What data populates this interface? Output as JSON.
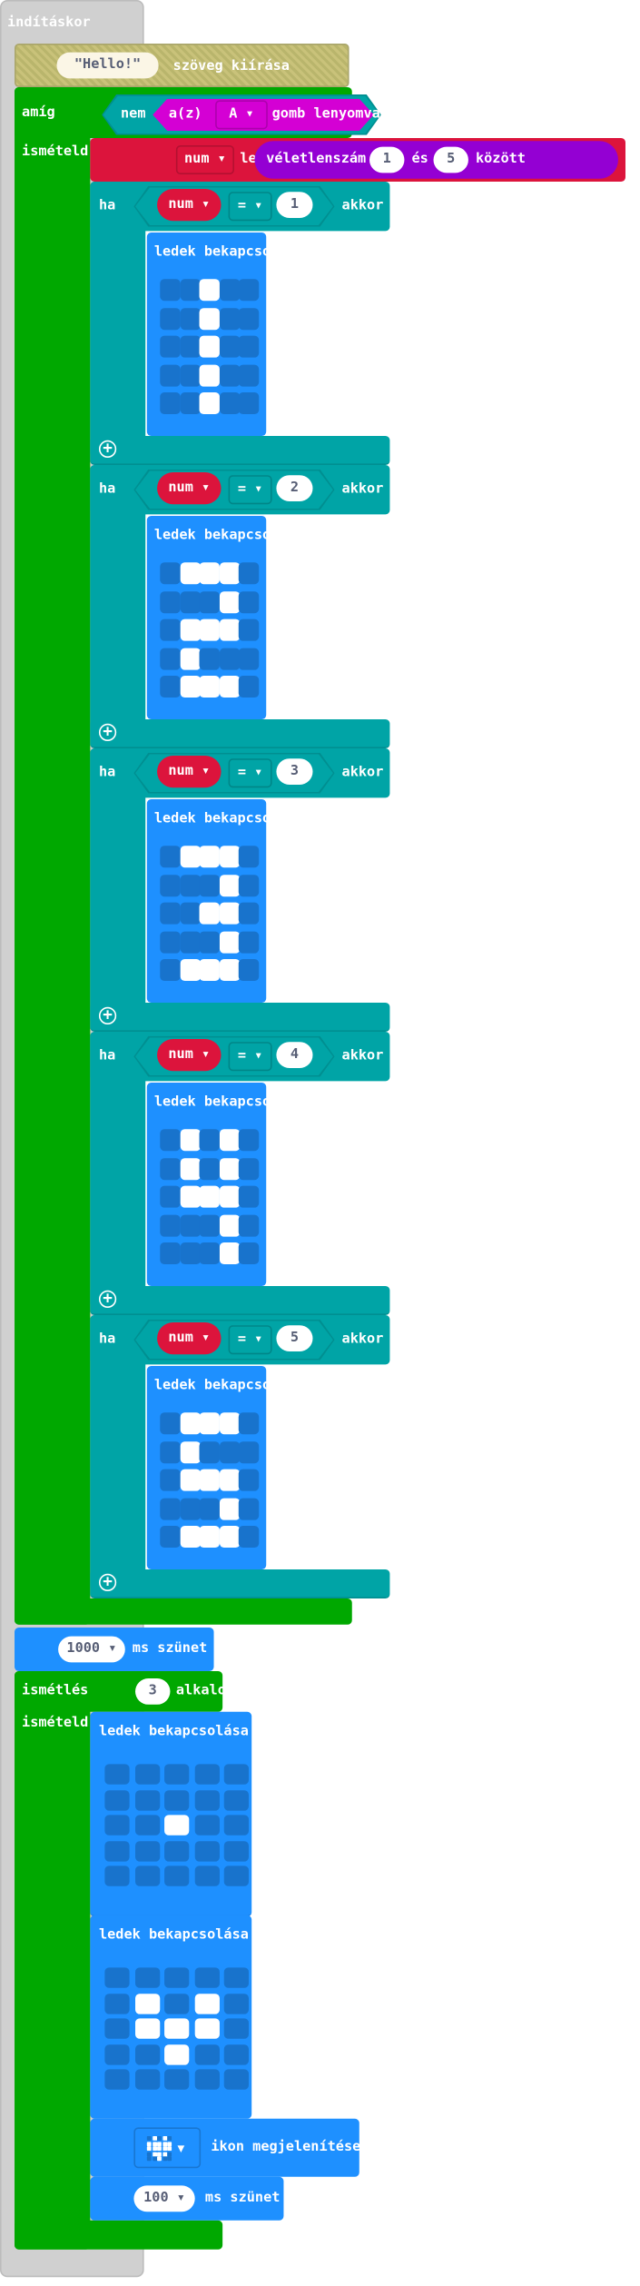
{
  "hat": {
    "label": "indításkor"
  },
  "show_string": {
    "value": "\"Hello!\"",
    "label": "szöveg kiírása"
  },
  "while_block": {
    "label": "amíg",
    "do_label": "ismételd",
    "not_label": "nem",
    "button_prefix": "a(z)",
    "button_value": "A ▾",
    "button_suffix": "gomb lenyomva"
  },
  "set_block": {
    "variable": "num ▾",
    "label": "legyen",
    "random_label": "véletlenszám",
    "from": "1",
    "and_label": "és",
    "to": "5",
    "between_label": "között"
  },
  "if_blocks": [
    {
      "if_label": "ha",
      "variable": "num ▾",
      "operator": "= ▾",
      "value": "1",
      "then_label": "akkor",
      "leds_label": "ledek bekapcsolása",
      "leds": [
        "..#..",
        "..#..",
        "..#..",
        "..#..",
        "..#.."
      ]
    },
    {
      "if_label": "ha",
      "variable": "num ▾",
      "operator": "= ▾",
      "value": "2",
      "then_label": "akkor",
      "leds_label": "ledek bekapcsolása",
      "leds": [
        ".###.",
        "...#.",
        ".###.",
        ".#...",
        ".###."
      ]
    },
    {
      "if_label": "ha",
      "variable": "num ▾",
      "operator": "= ▾",
      "value": "3",
      "then_label": "akkor",
      "leds_label": "ledek bekapcsolása",
      "leds": [
        ".###.",
        "...#.",
        "..##.",
        "...#.",
        ".###."
      ]
    },
    {
      "if_label": "ha",
      "variable": "num ▾",
      "operator": "= ▾",
      "value": "4",
      "then_label": "akkor",
      "leds_label": "ledek bekapcsolása",
      "leds": [
        ".#.#.",
        ".#.#.",
        ".###.",
        "...#.",
        "...#."
      ]
    },
    {
      "if_label": "ha",
      "variable": "num ▾",
      "operator": "= ▾",
      "value": "5",
      "then_label": "akkor",
      "leds_label": "ledek bekapcsolása",
      "leds": [
        ".###.",
        ".#...",
        ".###.",
        "...#.",
        ".###."
      ]
    }
  ],
  "pause1": {
    "value": "1000 ▾",
    "label": "ms szünet"
  },
  "repeat_block": {
    "label": "ismétlés",
    "times": "3",
    "times_label": "alkalommal",
    "do_label": "ismételd",
    "leds_blocks": [
      {
        "label": "ledek bekapcsolása",
        "leds": [
          ".....",
          ".....",
          "..#..",
          ".....",
          "....."
        ]
      },
      {
        "label": "ledek bekapcsolása",
        "leds": [
          ".....",
          ".#.#.",
          ".###.",
          "..#..",
          "....."
        ]
      }
    ],
    "show_icon": {
      "icon": "heart-icon",
      "icon_leds": [
        ".#.#.",
        "#####",
        "#####",
        ".###.",
        "..#.."
      ],
      "label": "ikon megjelenítése"
    },
    "pause": {
      "value": "100 ▾",
      "label": "ms szünet"
    }
  },
  "colors": {
    "hat": "#d0d0d0",
    "loops": "#00a800",
    "logic": "#00a4a6",
    "basic": "#1e90ff",
    "variables": "#dc143c",
    "math": "#9400d3",
    "input": "#d400d4"
  }
}
